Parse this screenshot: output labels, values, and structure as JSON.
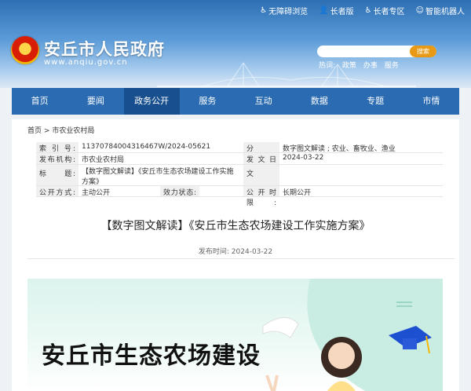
{
  "topbar": {
    "items": [
      {
        "icon": "accessibility-icon",
        "label": "无障碍浏览"
      },
      {
        "icon": "elder-icon",
        "label": "长者版"
      },
      {
        "icon": "elder-zone-icon",
        "label": "长者专区"
      },
      {
        "icon": "robot-icon",
        "label": "智能机器人"
      }
    ]
  },
  "site": {
    "title": "安丘市人民政府",
    "url": "www.anqiu.gov.cn"
  },
  "search": {
    "placeholder": "",
    "button": "搜索",
    "hot_label": "热词:",
    "hot_words": [
      "政策",
      "办事",
      "服务"
    ]
  },
  "nav": {
    "items": [
      "首页",
      "要闻",
      "政务公开",
      "服务",
      "互动",
      "数据",
      "专题",
      "市情"
    ],
    "active": "政务公开"
  },
  "breadcrumb": {
    "home": "首页",
    "sep": ">",
    "current": "市农业农村局"
  },
  "meta": {
    "index_label": "索 引 号:",
    "index": "11370784004316467W/2024-05621",
    "category_label": "分　　类:",
    "category": "数字图文解读 ; 农业、畜牧业、渔业",
    "org_label": "发布机构:",
    "org": "市农业农村局",
    "date_label": "发文日期:",
    "date": "2024-03-22",
    "title_label": "标　　题:",
    "title": "【数字图文解读】《安丘市生态农场建设工作实施方案》",
    "docno_label": "文　　号:",
    "docno": "",
    "mode_label": "公开方式:",
    "mode": "主动公开",
    "validity_label": "效力状态:",
    "validity": "",
    "period_label": "公开时限:",
    "period": "长期公开"
  },
  "article": {
    "title": "【数字图文解读】《安丘市生态农场建设工作实施方案》",
    "pubtime_label": "发布时间:",
    "pubtime": "2024-03-22"
  },
  "banner": {
    "title": "安丘市生态农场建设"
  }
}
